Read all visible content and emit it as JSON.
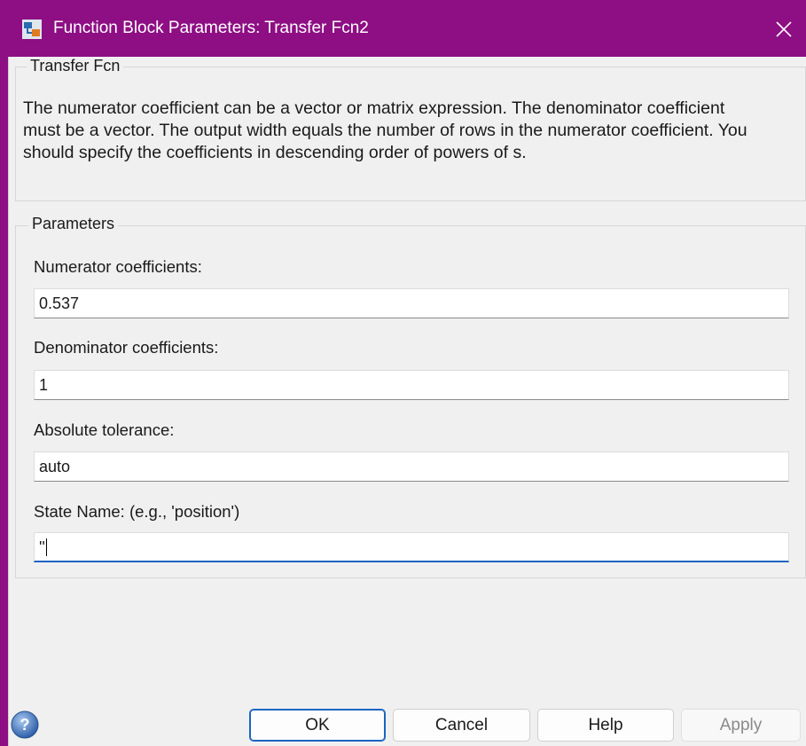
{
  "window": {
    "title": "Function Block Parameters: Transfer Fcn2",
    "accent_color": "#8e0e84"
  },
  "block": {
    "group_title": "Transfer Fcn",
    "description": "The numerator coefficient can be a vector or matrix expression. The denominator coefficient must be a vector. The output width equals the number of rows in the numerator coefficient. You should specify the coefficients in descending order of powers of s."
  },
  "parameters": {
    "group_title": "Parameters",
    "numerator_label": "Numerator coefficients:",
    "numerator_value": "0.537",
    "denominator_label": "Denominator coefficients:",
    "denominator_value": "1",
    "tolerance_label": "Absolute tolerance:",
    "tolerance_value": "auto",
    "state_name_label": "State Name: (e.g., 'position')",
    "state_name_value": "''"
  },
  "buttons": {
    "ok": "OK",
    "cancel": "Cancel",
    "help": "Help",
    "apply": "Apply"
  },
  "icons": {
    "app": "simulink-block-icon",
    "close": "close-icon",
    "help": "help-icon"
  }
}
